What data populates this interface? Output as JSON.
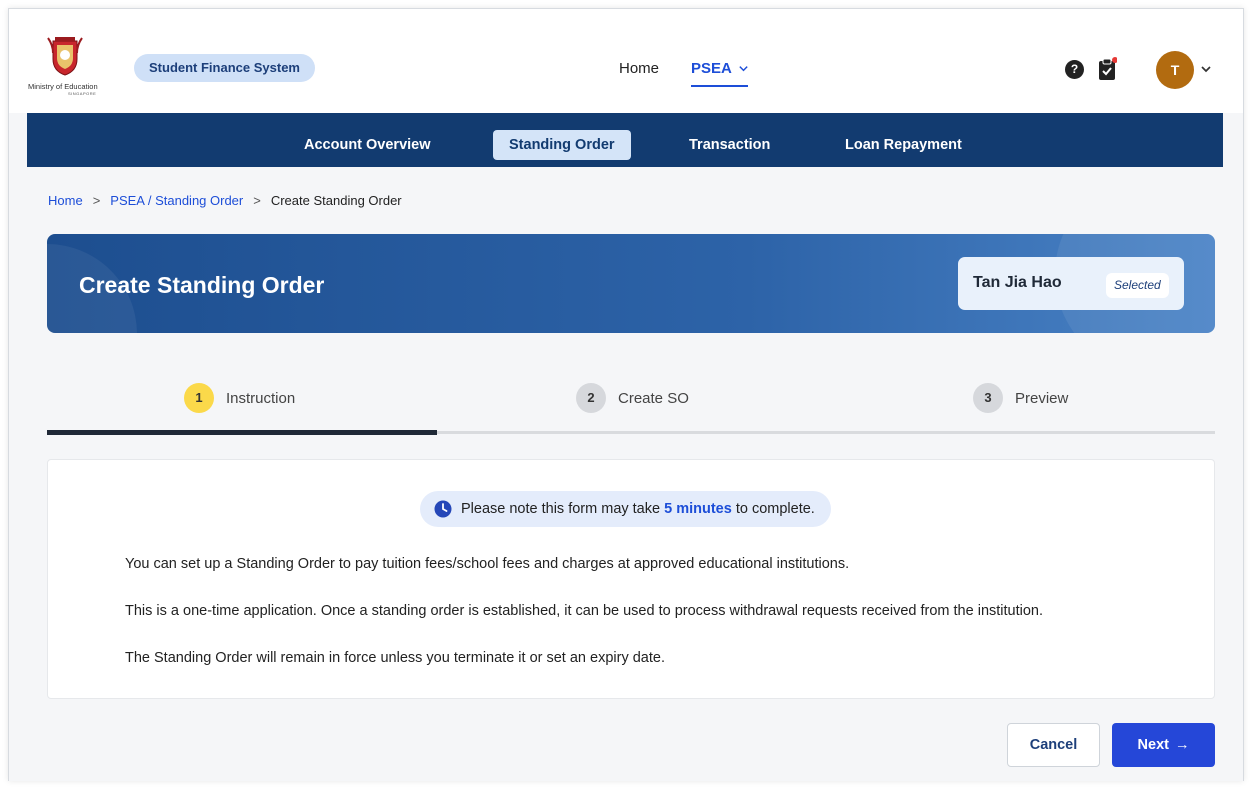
{
  "header": {
    "ministry_name": "Ministry of Education",
    "ministry_country": "SINGAPORE",
    "system_name": "Student Finance System",
    "nav": {
      "home": "Home",
      "psea": "PSEA"
    },
    "avatar_initial": "T",
    "help_symbol": "?"
  },
  "subnav": {
    "items": [
      "Account Overview",
      "Standing Order",
      "Transaction",
      "Loan Repayment"
    ],
    "active": "Standing Order"
  },
  "breadcrumb": {
    "items": [
      "Home",
      "PSEA / Standing Order",
      "Create Standing Order"
    ],
    "separator": ">"
  },
  "hero": {
    "title": "Create Standing Order",
    "student_name": "Tan Jia Hao",
    "student_badge": "Selected"
  },
  "stepper": {
    "steps": [
      {
        "number": "1",
        "label": "Instruction"
      },
      {
        "number": "2",
        "label": "Create SO"
      },
      {
        "number": "3",
        "label": "Preview"
      }
    ],
    "active_step": 1
  },
  "content": {
    "note_prefix": "Please note this form may take",
    "note_highlight": "5 minutes",
    "note_suffix": "to complete.",
    "paragraphs": [
      "You can set up a Standing Order to pay tuition fees/school fees and charges at approved educational institutions.",
      "This is a one-time application. Once a standing order is established, it can be used to process withdrawal requests received from the institution.",
      "The Standing Order will remain in force unless you terminate it or set an expiry date."
    ]
  },
  "actions": {
    "cancel": "Cancel",
    "next": "Next",
    "next_arrow": "→"
  },
  "colors": {
    "primary_navy": "#123b70",
    "accent_blue": "#1d4ed8",
    "button_blue": "#2547d8",
    "step_active": "#fbd94a",
    "avatar": "#b26b10"
  },
  "icons": [
    "moe-crest-icon",
    "chevron-down-icon",
    "help-icon",
    "clipboard-check-icon",
    "clock-icon",
    "arrow-right-icon"
  ]
}
